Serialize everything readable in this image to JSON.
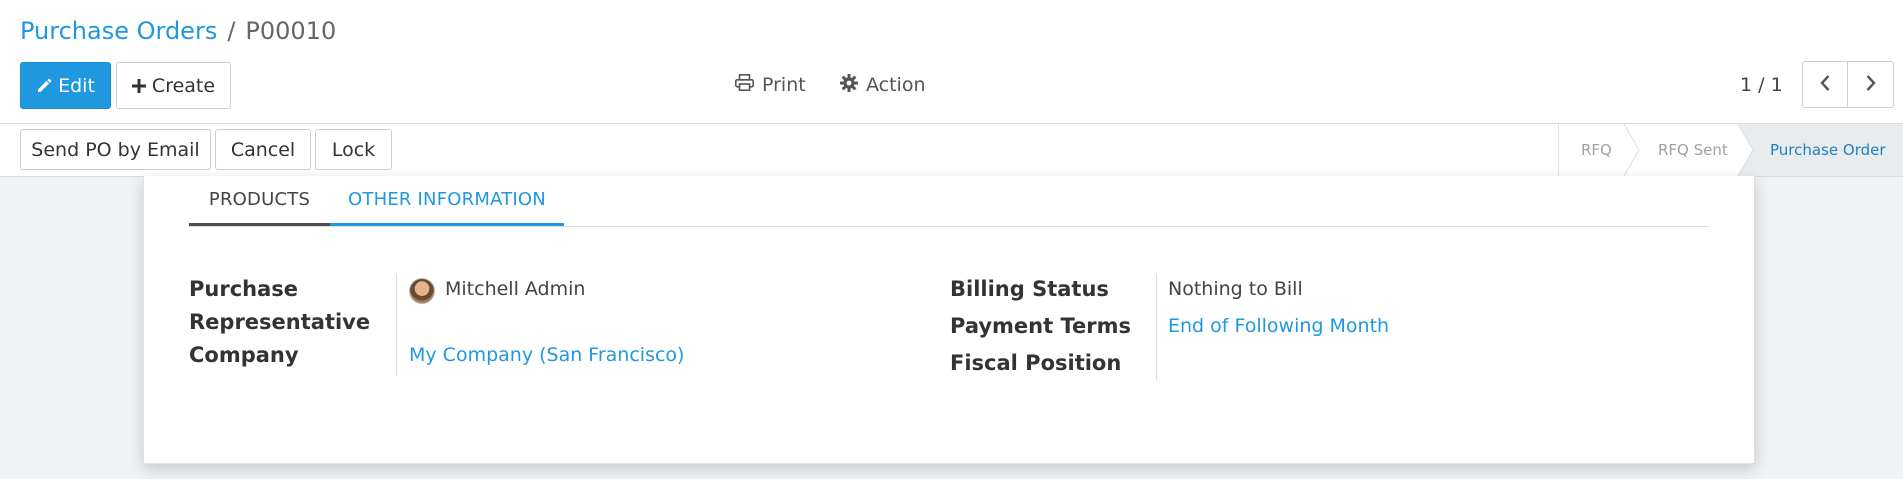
{
  "breadcrumb": {
    "parent": "Purchase Orders",
    "separator": "/",
    "current": "P00010"
  },
  "toolbar": {
    "edit_label": "Edit",
    "create_label": "Create",
    "print_label": "Print",
    "action_label": "Action"
  },
  "pager": {
    "value": "1 / 1"
  },
  "statusbar": {
    "buttons": [
      "Send PO by Email",
      "Cancel",
      "Lock"
    ],
    "stages": [
      "RFQ",
      "RFQ Sent",
      "Purchase Order"
    ],
    "active_stage": "Purchase Order"
  },
  "tabs": [
    {
      "label": "PRODUCTS"
    },
    {
      "label": "OTHER INFORMATION",
      "active": true
    }
  ],
  "fields_left": {
    "purchase_representative": {
      "label_line1": "Purchase",
      "label_line2": "Representative",
      "value": "Mitchell Admin"
    },
    "company": {
      "label": "Company",
      "value": "My Company (San Francisco)"
    }
  },
  "fields_right": {
    "billing_status": {
      "label": "Billing Status",
      "value": "Nothing to Bill"
    },
    "payment_terms": {
      "label": "Payment Terms",
      "value": "End of Following Month"
    },
    "fiscal_position": {
      "label": "Fiscal Position",
      "value": ""
    }
  },
  "colors": {
    "accent": "#1f98e0",
    "background": "#f0f3f5",
    "active_stage_bg": "#e9ecef"
  }
}
